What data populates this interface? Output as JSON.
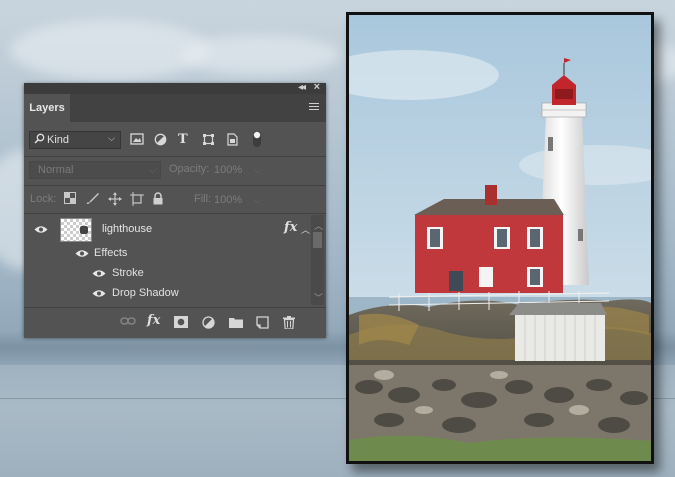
{
  "panel": {
    "collapse_icon": "double-chevron-left-icon",
    "close_icon": "close-icon",
    "tab_label": "Layers",
    "menu_icon": "hamburger-icon"
  },
  "filter": {
    "kind_label": "Kind",
    "icons": [
      "search-icon",
      "image-filter-icon",
      "adjustment-filter-icon",
      "type-filter-icon",
      "shape-filter-icon",
      "smart-object-filter-icon",
      "filter-toggle-icon"
    ]
  },
  "blend": {
    "mode": "Normal",
    "opacity_label": "Opacity:",
    "opacity_value": "100%"
  },
  "lock": {
    "label": "Lock:",
    "icons": [
      "lock-transparent-pixels-icon",
      "lock-image-pixels-icon",
      "lock-position-icon",
      "lock-artboard-icon",
      "lock-all-icon"
    ],
    "fill_label": "Fill:",
    "fill_value": "100%"
  },
  "layers": [
    {
      "name": "lighthouse",
      "fx_label": "fx",
      "visible": true,
      "effects_label": "Effects",
      "effects": [
        "Stroke",
        "Drop Shadow"
      ]
    }
  ],
  "bottom_icons": [
    "link-layers-icon",
    "fx-icon",
    "add-mask-icon",
    "adjustment-layer-icon",
    "new-group-icon",
    "new-layer-icon",
    "trash-icon"
  ],
  "colors": {
    "panel_bg": "#535353",
    "panel_header": "#424242",
    "text": "#d6d6d6",
    "lighthouse_red": "#c0262b"
  }
}
